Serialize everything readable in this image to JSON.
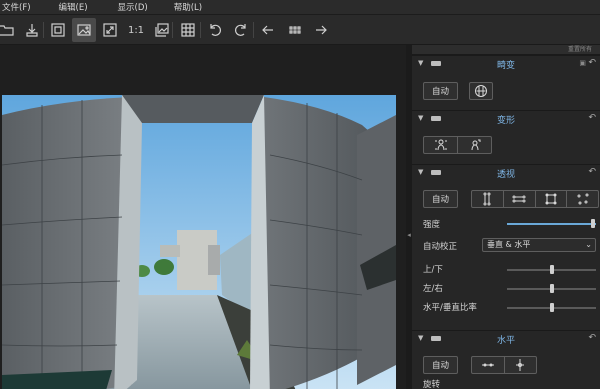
{
  "menu": {
    "items": [
      {
        "label": "文件(F)"
      },
      {
        "label": "编辑(E)"
      },
      {
        "label": "显示(D)"
      },
      {
        "label": "帮助(L)"
      }
    ]
  },
  "toolbar": {
    "actual_size_label": "1:1"
  },
  "panel": {
    "header_hint": "重置所有",
    "sections": {
      "dodge": {
        "title": "畸变",
        "auto_label": "自动"
      },
      "transform": {
        "title": "变形"
      },
      "perspective": {
        "title": "透视",
        "auto_label": "自动",
        "strength_label": "强度",
        "strength_value": 0.97,
        "auto_correct_label": "自动校正",
        "auto_correct_value": "垂直 & 水平",
        "updown_label": "上/下",
        "updown_value": 0.5,
        "leftright_label": "左/右",
        "leftright_value": 0.5,
        "ratio_label": "水平/垂直比率",
        "ratio_value": 0.5
      },
      "horizon": {
        "title": "水平",
        "auto_label": "自动",
        "rotate_label": "旋转"
      }
    }
  },
  "colors": {
    "accent": "#7fb6e6",
    "sky": "#8fc3e8",
    "concrete": "#6b7074"
  }
}
